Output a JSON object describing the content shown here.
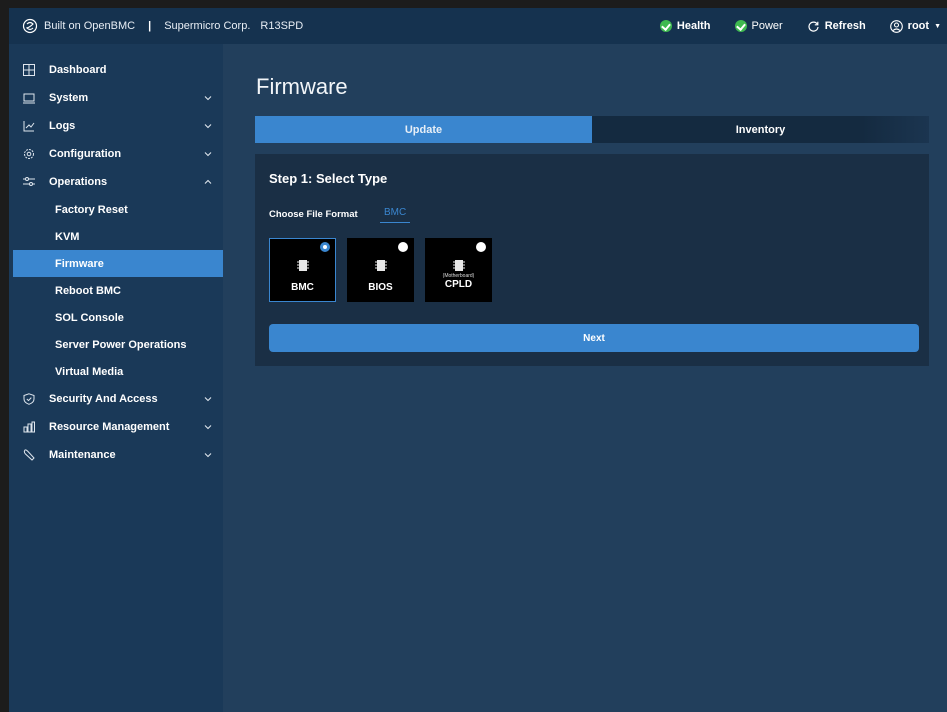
{
  "topbar": {
    "built_on": "Built on OpenBMC",
    "separator": "|",
    "vendor": "Supermicro Corp.",
    "model": "R13SPD",
    "health_label": "Health",
    "power_label": "Power",
    "refresh_label": "Refresh",
    "user_label": "root",
    "status_color": "#3fb950"
  },
  "sidebar": {
    "items": [
      {
        "label": "Dashboard",
        "icon": "dashboard-icon"
      },
      {
        "label": "System",
        "icon": "monitor-icon"
      },
      {
        "label": "Logs",
        "icon": "logs-icon"
      },
      {
        "label": "Configuration",
        "icon": "gear-icon"
      },
      {
        "label": "Operations",
        "icon": "sliders-icon"
      },
      {
        "label": "Security And Access",
        "icon": "shield-icon"
      },
      {
        "label": "Resource Management",
        "icon": "chart-icon"
      },
      {
        "label": "Maintenance",
        "icon": "wrench-icon"
      }
    ],
    "operations_sub": [
      {
        "label": "Factory Reset"
      },
      {
        "label": "KVM"
      },
      {
        "label": "Firmware"
      },
      {
        "label": "Reboot BMC"
      },
      {
        "label": "SOL Console"
      },
      {
        "label": "Server Power Operations"
      },
      {
        "label": "Virtual Media"
      }
    ],
    "active_item": "Firmware"
  },
  "main": {
    "title": "Firmware",
    "tabs": [
      {
        "label": "Update",
        "active": true
      },
      {
        "label": "Inventory",
        "active": false
      }
    ],
    "step_title": "Step 1: Select Type",
    "file_format_label": "Choose File Format",
    "file_format_value": "BMC",
    "types": [
      {
        "label": "BMC",
        "sub": "",
        "selected": true
      },
      {
        "label": "BIOS",
        "sub": "",
        "selected": false
      },
      {
        "label": "CPLD",
        "sub": "(Motherboard)",
        "selected": false
      }
    ],
    "next_label": "Next"
  },
  "colors": {
    "accent": "#3a86cf",
    "topbar_bg": "#15324f",
    "sidebar_bg": "#1a3958",
    "main_bg": "#223f5c",
    "card_bg": "#1a2f45"
  }
}
